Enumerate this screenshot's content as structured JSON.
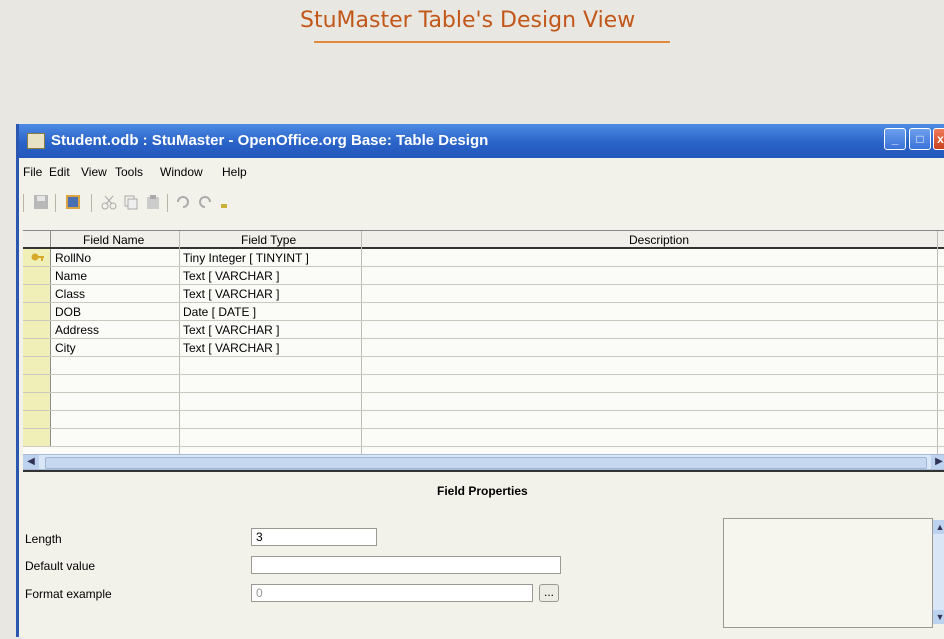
{
  "page": {
    "heading": "StuMaster Table's Design View"
  },
  "window": {
    "title": "Student.odb : StuMaster - OpenOffice.org Base: Table Design",
    "menu": [
      "File",
      "Edit",
      "View",
      "Tools",
      "Window",
      "Help"
    ]
  },
  "table_design": {
    "headers": {
      "field_name": "Field Name",
      "field_type": "Field Type",
      "description": "Description"
    },
    "rows": [
      {
        "name": "RollNo",
        "type": "Tiny Integer [ TINYINT ]",
        "description": "",
        "primary_key": true
      },
      {
        "name": "Name",
        "type": "Text [ VARCHAR ]",
        "description": ""
      },
      {
        "name": "Class",
        "type": "Text [ VARCHAR ]",
        "description": ""
      },
      {
        "name": "DOB",
        "type": "Date [ DATE ]",
        "description": ""
      },
      {
        "name": "Address",
        "type": "Text [ VARCHAR ]",
        "description": ""
      },
      {
        "name": "City",
        "type": "Text [ VARCHAR ]",
        "description": ""
      }
    ]
  },
  "field_properties": {
    "title": "Field Properties",
    "length_label": "Length",
    "length_value": "3",
    "default_label": "Default value",
    "default_value": "",
    "format_label": "Format example",
    "format_value": "0",
    "format_button": "..."
  },
  "colors": {
    "titlebar": "#2a63c8",
    "heading": "#c2571a",
    "row_handle": "#f1efb8"
  },
  "icons": [
    "save-icon",
    "edit-icon",
    "cut-icon",
    "copy-icon",
    "paste-icon",
    "undo-icon",
    "redo-icon",
    "primary-key-icon"
  ]
}
